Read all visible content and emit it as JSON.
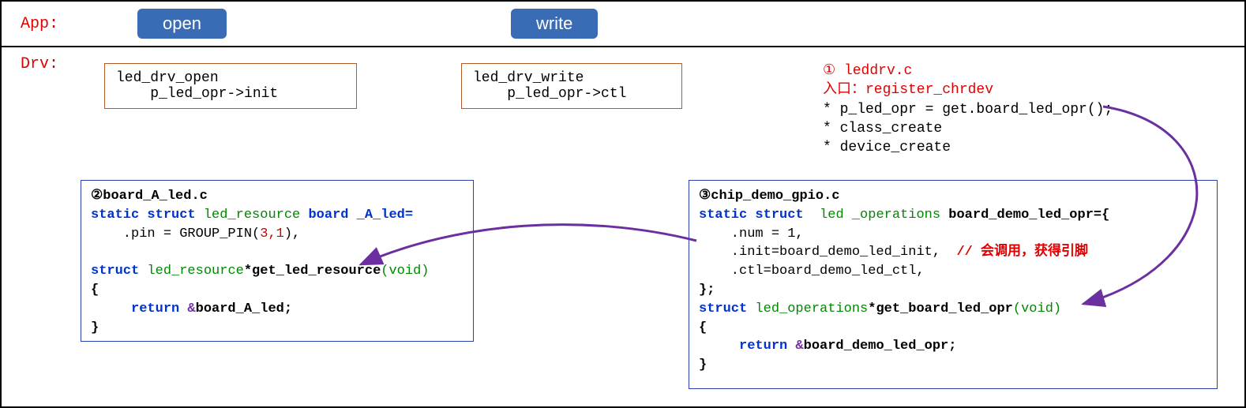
{
  "app": {
    "label": "App:",
    "btn_open": "open",
    "btn_write": "write"
  },
  "drv": {
    "label": "Drv:",
    "open_box_l1": "led_drv_open",
    "open_box_l2": "    p_led_opr->init",
    "write_box_l1": "led_drv_write",
    "write_box_l2": "    p_led_opr->ctl",
    "notes_l1": "① leddrv.c",
    "notes_l2": "入口：register_chrdev",
    "notes_l3": "* p_led_opr = get.board_led_opr();",
    "notes_l4": "* class_create",
    "notes_l5": "* device_create"
  },
  "box2": {
    "title": "②board_A_led.c",
    "l1_static": "static ",
    "l1_struct": "struct ",
    "l1_type": "led_resource ",
    "l1_rest": "board _A_led=",
    "l2_pin": "    .pin = GROUP_PIN(",
    "l2_args": "3,1",
    "l2_end": "),",
    "l3_struct": "struct ",
    "l3_type": "led_resource",
    "l3_star": "*",
    "l3_fn": "get_led_resource",
    "l3_paren": "(",
    "l3_void": "void",
    "l3_close": ")",
    "l4": "{",
    "l5_ret": "     return ",
    "l5_amp": "&",
    "l5_val": "board_A_led;",
    "l6": "}"
  },
  "box3": {
    "title": "③chip_demo_gpio.c",
    "l1_static": "static ",
    "l1_struct": "struct  ",
    "l1_type": "led _operations ",
    "l1_rest": "board_demo_led_opr={",
    "l2": "    .num = 1,",
    "l3_init": "    .init=board_demo_led_init,  ",
    "l3_cmt": "// 会调用，获得引脚",
    "l4": "    .ctl=board_demo_led_ctl,",
    "l5": "};",
    "l6_struct": "struct ",
    "l6_type": "led_operations",
    "l6_star": "*",
    "l6_fn": "get_board_led_opr",
    "l6_paren": "(",
    "l6_void": "void",
    "l6_close": ")",
    "l7": "{",
    "l8_ret": "     return ",
    "l8_amp": "&",
    "l8_val": "board_demo_led_opr;",
    "l9": "}"
  }
}
